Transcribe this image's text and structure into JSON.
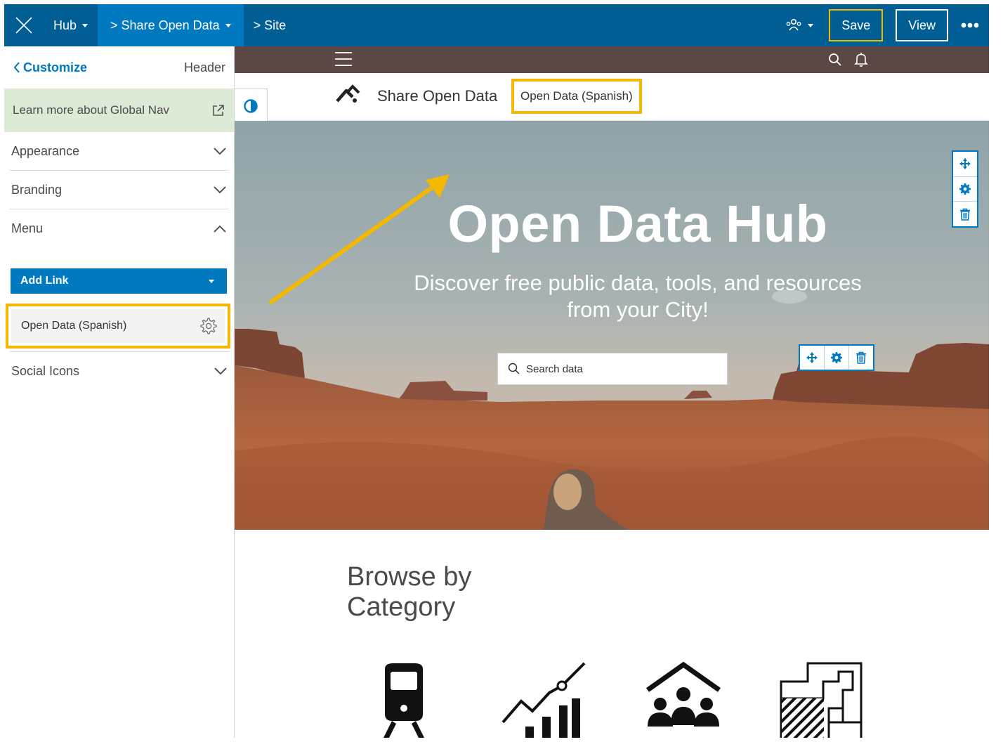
{
  "topbar": {
    "hub_label": "Hub",
    "site_crumb": "> Share Open Data",
    "site_link": "> Site",
    "save_label": "Save",
    "view_label": "View",
    "icons": {
      "close": "close-icon",
      "people": "people-icon",
      "more": "more-icon"
    }
  },
  "panel": {
    "back_label": "Customize",
    "section_title": "Header",
    "notice": "Learn more about Global Nav",
    "sections": {
      "appearance": "Appearance",
      "branding": "Branding",
      "menu": "Menu",
      "social": "Social Icons"
    },
    "add_link_label": "Add Link",
    "menu_links": [
      "Open Data (Spanish)"
    ]
  },
  "site": {
    "title": "Share Open Data",
    "menu_link": "Open Data (Spanish)",
    "hero_title": "Open Data Hub",
    "hero_subtitle_line1": "Discover free public data, tools, and resources",
    "hero_subtitle_line2": "from your City!",
    "search_placeholder": "Search data",
    "browse_title_line1": "Browse by",
    "browse_title_line2": "Category"
  },
  "colors": {
    "topbar": "#005e95",
    "topbar_active": "#0079c1",
    "accent": "#0079c1",
    "highlight": "#f5b800",
    "global_nav": "#5b4845",
    "notice_bg": "#dcebd5"
  }
}
